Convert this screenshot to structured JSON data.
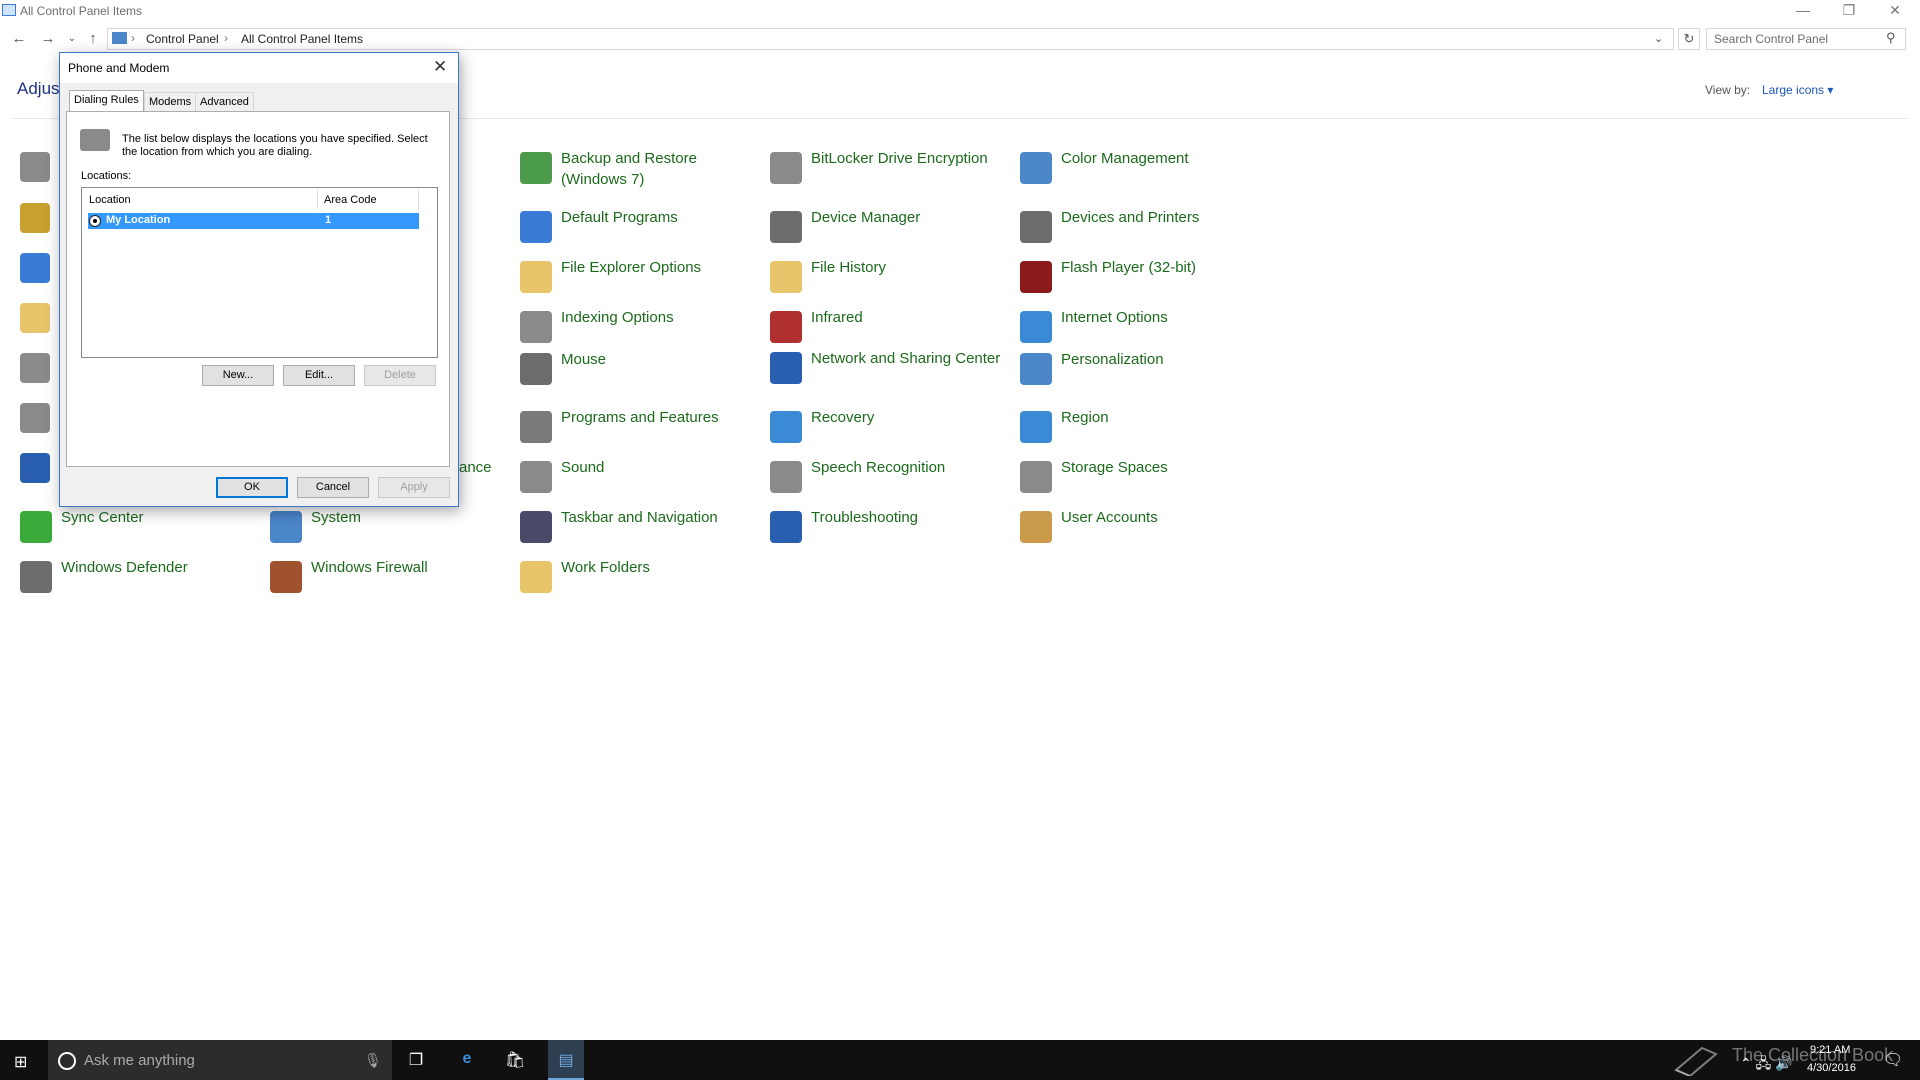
{
  "window": {
    "title": "All Control Panel Items",
    "minimize": "—",
    "restore": "❐",
    "close": "✕"
  },
  "address_bar": {
    "breadcrumb": [
      "Control Panel",
      "All Control Panel Items"
    ],
    "search_placeholder": "Search Control Panel"
  },
  "header": {
    "adjust_text": "Adjust",
    "view_by_label": "View by:",
    "view_by_value": "Large icons ▾"
  },
  "items": [
    {
      "label": "Backup and Restore (Windows 7)",
      "icon": "backup-icon",
      "color": "#4c9a4c"
    },
    {
      "label": "BitLocker Drive Encryption",
      "icon": "bitlocker-icon",
      "color": "#8a8a8a"
    },
    {
      "label": "Color Management",
      "icon": "color-management-icon",
      "color": "#4a86c8"
    },
    {
      "label": "Default Programs",
      "icon": "default-programs-icon",
      "color": "#3a7bd5"
    },
    {
      "label": "Device Manager",
      "icon": "device-manager-icon",
      "color": "#6d6d6d"
    },
    {
      "label": "Devices and Printers",
      "icon": "printer-icon",
      "color": "#6d6d6d"
    },
    {
      "label": "File Explorer Options",
      "icon": "folder-options-icon",
      "color": "#e8c46a"
    },
    {
      "label": "File History",
      "icon": "file-history-icon",
      "color": "#e8c46a"
    },
    {
      "label": "Flash Player (32-bit)",
      "icon": "flash-icon",
      "color": "#8b1a1a"
    },
    {
      "label": "Indexing Options",
      "icon": "indexing-icon",
      "color": "#8a8a8a"
    },
    {
      "label": "Infrared",
      "icon": "infrared-icon",
      "color": "#b03030"
    },
    {
      "label": "Internet Options",
      "icon": "internet-options-icon",
      "color": "#3a8ad5"
    },
    {
      "label": "Mouse",
      "icon": "mouse-icon",
      "color": "#6d6d6d"
    },
    {
      "label": "Network and Sharing Center",
      "icon": "network-icon",
      "color": "#2a5fb0"
    },
    {
      "label": "Personalization",
      "icon": "personalization-icon",
      "color": "#4a86c8"
    },
    {
      "label": "Programs and Features",
      "icon": "programs-icon",
      "color": "#7a7a7a"
    },
    {
      "label": "Recovery",
      "icon": "recovery-icon",
      "color": "#3a8ad5"
    },
    {
      "label": "Region",
      "icon": "region-icon",
      "color": "#3a8ad5"
    },
    {
      "label": "Sound",
      "icon": "sound-icon",
      "color": "#8a8a8a"
    },
    {
      "label": "Speech Recognition",
      "icon": "microphone-icon",
      "color": "#8a8a8a"
    },
    {
      "label": "Storage Spaces",
      "icon": "storage-icon",
      "color": "#8a8a8a"
    },
    {
      "label": "Taskbar and Navigation",
      "icon": "taskbar-icon",
      "color": "#4a4a6a"
    },
    {
      "label": "Troubleshooting",
      "icon": "troubleshooting-icon",
      "color": "#2a5fb0"
    },
    {
      "label": "User Accounts",
      "icon": "user-accounts-icon",
      "color": "#c89a4a"
    },
    {
      "label": "Sync Center",
      "icon": "sync-icon",
      "color": "#3aaa3a"
    },
    {
      "label": "System",
      "icon": "system-icon",
      "color": "#4a86c8"
    },
    {
      "label": "Windows Defender",
      "icon": "defender-icon",
      "color": "#6d6d6d"
    },
    {
      "label": "Windows Firewall",
      "icon": "firewall-icon",
      "color": "#a0522d"
    },
    {
      "label": "Work Folders",
      "icon": "work-folders-icon",
      "color": "#e8c46a"
    },
    {
      "label": "ance",
      "icon": "",
      "color": ""
    }
  ],
  "left_column_icons": [
    {
      "icon": "administrative-tools-icon",
      "color": "#8a8a8a"
    },
    {
      "icon": "autoplay-icon",
      "color": "#c8a030"
    },
    {
      "icon": "display-icon",
      "color": "#3a7bd5"
    },
    {
      "icon": "fonts-icon",
      "color": "#e8c46a"
    },
    {
      "icon": "keyboard-icon",
      "color": "#8a8a8a"
    },
    {
      "icon": "phone-modem-icon",
      "color": "#8a8a8a"
    },
    {
      "icon": "remoteapp-icon",
      "color": "#2a5fb0"
    }
  ],
  "dialog": {
    "title": "Phone and Modem",
    "close": "✕",
    "tabs": [
      "Dialing Rules",
      "Modems",
      "Advanced"
    ],
    "description": "The list below displays the locations you have specified. Select the location from which you are dialing.",
    "locations_label": "Locations:",
    "columns": [
      "Location",
      "Area Code"
    ],
    "rows": [
      {
        "location": "My Location",
        "area_code": "1"
      }
    ],
    "buttons": {
      "new": "New...",
      "edit": "Edit...",
      "delete": "Delete",
      "ok": "OK",
      "cancel": "Cancel",
      "apply": "Apply"
    }
  },
  "taskbar": {
    "search_placeholder": "Ask me anything",
    "time": "9:21 AM",
    "date": "4/30/2016",
    "watermark": "The Collection Book"
  }
}
